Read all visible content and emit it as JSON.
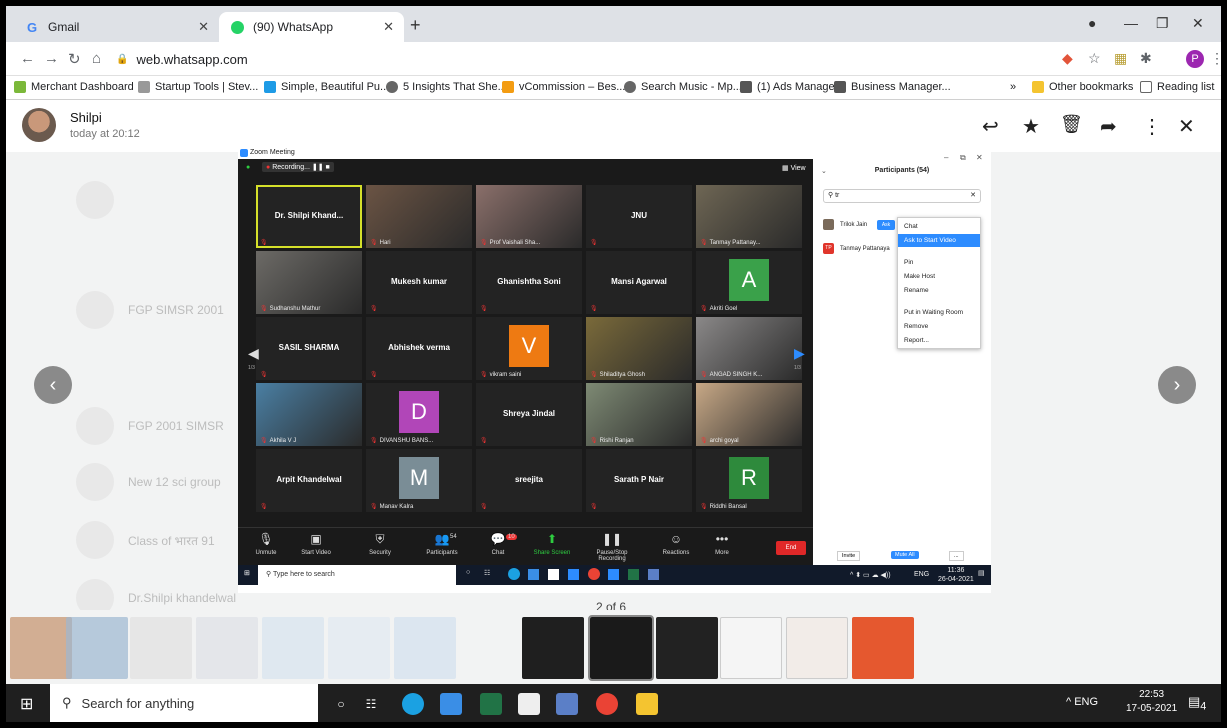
{
  "browser": {
    "tabs": [
      {
        "title": "Gmail",
        "icon": "gmail-icon"
      },
      {
        "title": "(90) WhatsApp",
        "icon": "whatsapp-icon"
      }
    ],
    "url": "web.whatsapp.com",
    "profile_initial": "P",
    "bookmarks": [
      "Merchant Dashboard",
      "Startup Tools | Stev...",
      "Simple, Beautiful Pu...",
      "5 Insights That She...",
      "vCommission – Bes...",
      "Search Music - Mp...",
      "(1) Ads Manager",
      "Business Manager...",
      "Other bookmarks",
      "Reading list"
    ],
    "bookmarks_more": "»"
  },
  "viewer": {
    "sender_name": "Shilpi",
    "sender_time": "today at 20:12",
    "counter": "2 of 6",
    "bg_rows": [
      "FGP SIMSR 2001",
      "FGP 2001 SIMSR",
      "New 12 sci group",
      "Class of भारत 91",
      "Dr.Shilpi khandelwal"
    ]
  },
  "zoom": {
    "title": "Zoom Meeting",
    "recording": "Recording...",
    "view": "View",
    "page_left": "1/3",
    "page_right": "1/3",
    "tiles": [
      {
        "name": "Dr. Shilpi Khand...",
        "label": "",
        "kind": "name"
      },
      {
        "name": "",
        "label": "Hari",
        "kind": "photo",
        "color": "#6b5444"
      },
      {
        "name": "",
        "label": "Prof Vaishali Sha...",
        "kind": "photo",
        "color": "#8a6f6a"
      },
      {
        "name": "JNU",
        "label": "",
        "kind": "name"
      },
      {
        "name": "",
        "label": "Tanmay Pattanay...",
        "kind": "photo",
        "color": "#6e6654"
      },
      {
        "name": "",
        "label": "Sudhanshu Mathur",
        "kind": "photo",
        "color": "#6c6a66"
      },
      {
        "name": "Mukesh kumar",
        "label": "",
        "kind": "name"
      },
      {
        "name": "Ghanishtha Soni",
        "label": "",
        "kind": "name"
      },
      {
        "name": "Mansi Agarwal",
        "label": "",
        "kind": "name"
      },
      {
        "name": "",
        "label": "Akriti Goel",
        "kind": "letter",
        "letter": "A",
        "color": "#3aa14a"
      },
      {
        "name": "SASIL SHARMA",
        "label": "",
        "kind": "name"
      },
      {
        "name": "Abhishek verma",
        "label": "",
        "kind": "name"
      },
      {
        "name": "",
        "label": "vikram saini",
        "kind": "letter",
        "letter": "V",
        "color": "#ee7a12"
      },
      {
        "name": "",
        "label": "Shiladitya Ghosh",
        "kind": "photo",
        "color": "#7a6a3a"
      },
      {
        "name": "",
        "label": "ANGAD SINGH K...",
        "kind": "photo",
        "color": "#8a8888"
      },
      {
        "name": "",
        "label": "Akhila V J",
        "kind": "photo",
        "color": "#4a7fa3"
      },
      {
        "name": "",
        "label": "DIVANSHU BANS...",
        "kind": "letter",
        "letter": "D",
        "color": "#b146b8"
      },
      {
        "name": "Shreya Jindal",
        "label": "",
        "kind": "name"
      },
      {
        "name": "",
        "label": "Rishi Ranjan",
        "kind": "photo",
        "color": "#7e8a74"
      },
      {
        "name": "",
        "label": "archi goyal",
        "kind": "photo",
        "color": "#c7a886"
      },
      {
        "name": "Arpit Khandelwal",
        "label": "",
        "kind": "name"
      },
      {
        "name": "",
        "label": "Manav Kalra",
        "kind": "letter",
        "letter": "M",
        "color": "#7a8d96"
      },
      {
        "name": "sreejita",
        "label": "",
        "kind": "name"
      },
      {
        "name": "Sarath P Nair",
        "label": "",
        "kind": "name"
      },
      {
        "name": "",
        "label": "Riddhi Bansal",
        "kind": "letter",
        "letter": "R",
        "color": "#2e8a3c"
      }
    ],
    "controls": [
      {
        "label": "Unmute",
        "icon": "microphone-muted-icon"
      },
      {
        "label": "Start Video",
        "icon": "video-off-icon"
      },
      {
        "label": "Security",
        "icon": "shield-icon"
      },
      {
        "label": "Participants",
        "icon": "participants-icon",
        "count": "54"
      },
      {
        "label": "Chat",
        "icon": "chat-icon",
        "count": "10"
      },
      {
        "label": "Share Screen",
        "icon": "share-screen-icon"
      },
      {
        "label": "Pause/Stop Recording",
        "icon": "recording-icon"
      },
      {
        "label": "Reactions",
        "icon": "reactions-icon"
      },
      {
        "label": "More",
        "icon": "more-icon"
      }
    ],
    "end_label": "End",
    "participants": {
      "title": "Participants (54)",
      "search_value": "tr",
      "rows": [
        {
          "name": "Trilok Jain",
          "initials": "",
          "color": "#7a6a5a"
        },
        {
          "name": "Tanmay Pattanaya",
          "initials": "TP",
          "color": "#e0352b"
        }
      ],
      "ask_label": "Ask",
      "menu": [
        "Chat",
        "Ask to Start Video",
        "Pin",
        "Make Host",
        "Rename",
        "Put in Waiting Room",
        "Remove",
        "Report..."
      ],
      "invite": "Invite",
      "mute_all": "Mute All",
      "more": "..."
    },
    "taskbar": {
      "search": "Type here to search",
      "lang": "ENG",
      "time": "11:36",
      "date": "26-04-2021"
    }
  },
  "taskbar": {
    "search": "Search for anything",
    "lang": "ENG",
    "time": "22:53",
    "date": "17-05-2021",
    "notifications": "4"
  }
}
